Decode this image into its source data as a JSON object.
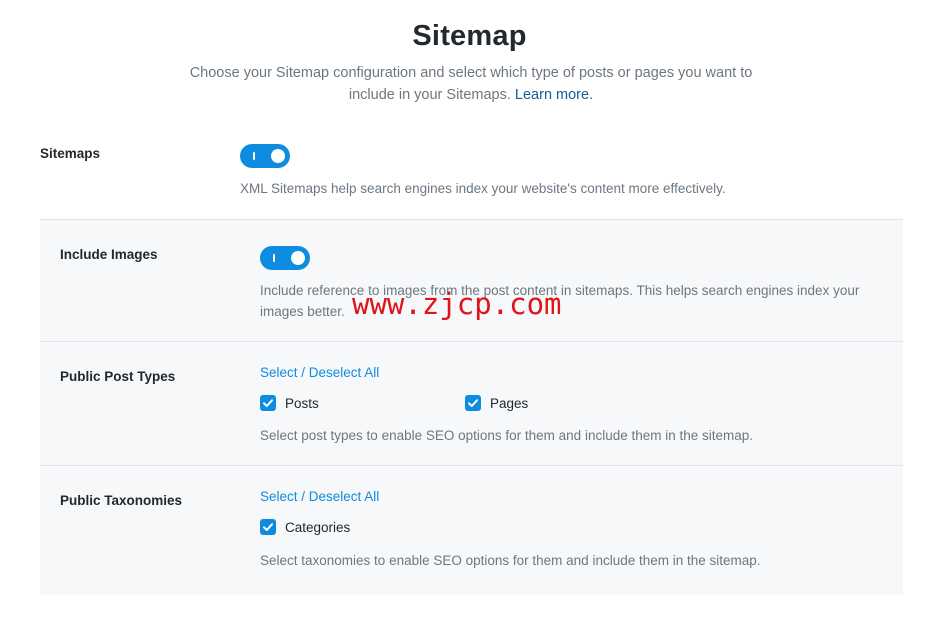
{
  "header": {
    "title": "Sitemap",
    "subtitle": "Choose your Sitemap configuration and select which type of posts or pages you want to include in your Sitemaps.",
    "learn_more": "Learn more."
  },
  "sitemaps": {
    "label": "Sitemaps",
    "enabled": true,
    "description": "XML Sitemaps help search engines index your website's content more effectively."
  },
  "include_images": {
    "label": "Include Images",
    "enabled": true,
    "description": "Include reference to images from the post content in sitemaps. This helps search engines index your images better."
  },
  "post_types": {
    "label": "Public Post Types",
    "select_all": "Select / Deselect All",
    "options": [
      {
        "label": "Posts",
        "checked": true
      },
      {
        "label": "Pages",
        "checked": true
      }
    ],
    "description": "Select post types to enable SEO options for them and include them in the sitemap."
  },
  "taxonomies": {
    "label": "Public Taxonomies",
    "select_all": "Select / Deselect All",
    "options": [
      {
        "label": "Categories",
        "checked": true
      }
    ],
    "description": "Select taxonomies to enable SEO options for them and include them in the sitemap."
  },
  "watermark": "www.zjcp.com",
  "colors": {
    "accent": "#0e8ce0",
    "link": "#135e96",
    "muted_text": "#6c7781",
    "row_background": "#f7f8f9",
    "watermark": "#e0131a"
  }
}
